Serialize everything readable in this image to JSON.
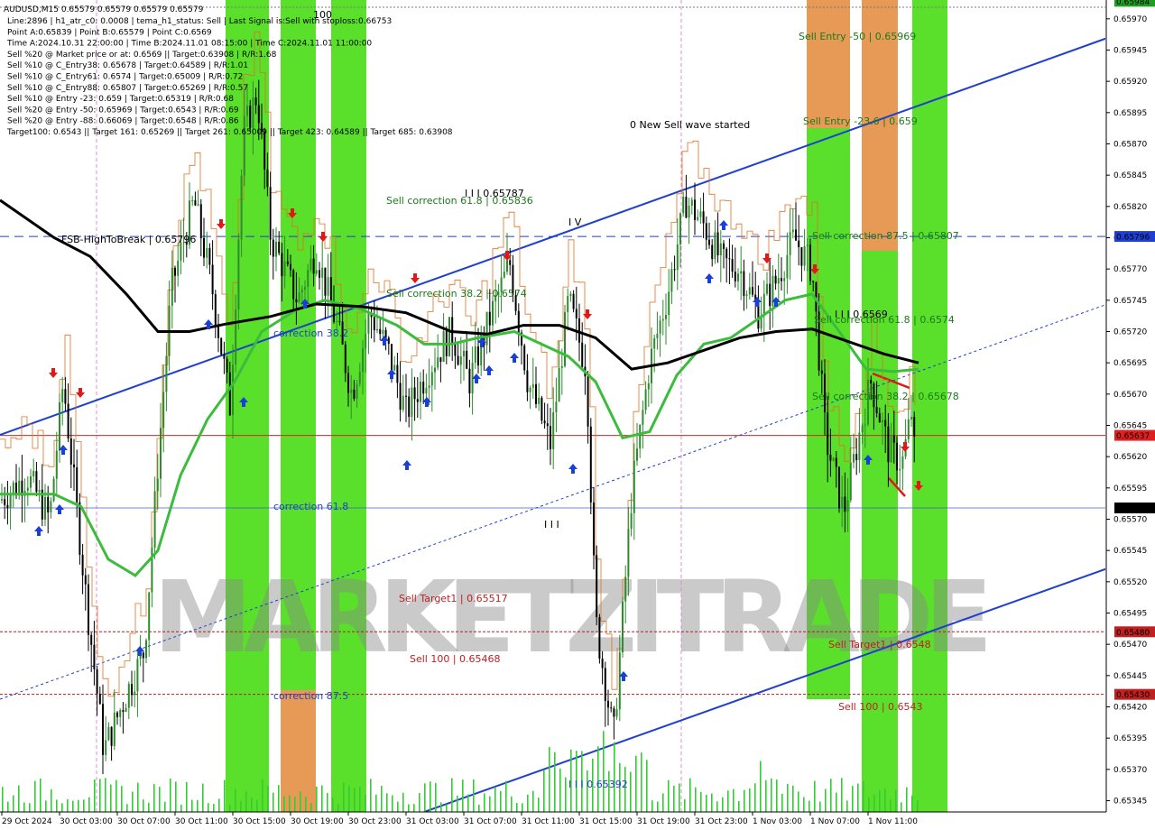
{
  "chart_data": {
    "type": "line",
    "symbol_line": "AUDUSD,M15  0.65579 0.65579 0.65579 0.65579",
    "info_lines": [
      "Line:2896 | h1_atr_c0: 0.0008 | tema_h1_status: Sell | Last Signal is:Sell with stoploss:0.66753",
      "Point A:0.65839 | Point B:0.65579 | Point C:0.6569",
      "Time A:2024.10.31 22:00:00 | Time B:2024.11.01 08:15:00 | Time C:2024.11.01 11:00:00",
      "Sell %20 @ Market price or at: 0.6569 || Target:0.63908 | R/R:1.68",
      "Sell %10 @ C_Entry38: 0.65678 | Target:0.64589 | R/R:1.01",
      "Sell %10 @ C_Entry61: 0.6574 | Target:0.65009 | R/R:0.72",
      "Sell %10 @ C_Entry88: 0.65807 | Target:0.65269 | R/R:0.57",
      "Sell %10 @ Entry -23: 0.659 | Target:0.65319 | R/R:0.68",
      "Sell %20 @ Entry -50: 0.65969 | Target:0.6543 | R/R:0.69",
      "Sell %20 @ Entry -88: 0.66069 | Target:0.6548 | R/R:0.86",
      "Target100: 0.6543 || Target 161: 0.65269 || Target 261: 0.65009 || Target 423: 0.64589 || Target 685: 0.63908"
    ],
    "y_ticks": [
      "0.65970",
      "0.65945",
      "0.65920",
      "0.65895",
      "0.65870",
      "0.65845",
      "0.65820",
      "0.65795",
      "0.65770",
      "0.65745",
      "0.65720",
      "0.65695",
      "0.65670",
      "0.65645",
      "0.65620",
      "0.65595",
      "0.65570",
      "0.65545",
      "0.65520",
      "0.65495",
      "0.65470",
      "0.65445",
      "0.65420",
      "0.65395",
      "0.65370",
      "0.65345"
    ],
    "y_range": [
      0.65336,
      0.65985
    ],
    "x_ticks": [
      "29 Oct 2024",
      "30 Oct 03:00",
      "30 Oct 07:00",
      "30 Oct 11:00",
      "30 Oct 15:00",
      "30 Oct 19:00",
      "30 Oct 23:00",
      "31 Oct 03:00",
      "31 Oct 07:00",
      "31 Oct 11:00",
      "31 Oct 15:00",
      "31 Oct 19:00",
      "31 Oct 23:00",
      "1 Nov 03:00",
      "1 Nov 07:00",
      "1 Nov 11:00"
    ],
    "price_tags": [
      {
        "value": 0.65984,
        "text": "0.65984",
        "bg": "#1e9e1e"
      },
      {
        "value": 0.65796,
        "text": "0.65796",
        "bg": "#1f3fd0"
      },
      {
        "value": 0.65637,
        "text": "0.65637",
        "bg": "#e02020"
      },
      {
        "value": 0.65579,
        "text": "0.65579",
        "bg": "#000000"
      },
      {
        "value": 0.6548,
        "text": "0.65480",
        "bg": "#c02020"
      },
      {
        "value": 0.6543,
        "text": "0.65430",
        "bg": "#c02020"
      }
    ],
    "annotations": [
      {
        "text": "Sell Entry -50 | 0.65969",
        "color": "#1a7a1a"
      },
      {
        "text": "Sell Entry -23.6 | 0.659",
        "color": "#1a7a1a"
      },
      {
        "text": "0 New Sell wave started",
        "color": "#000000"
      },
      {
        "text": "Sell correction 61.8 | 0.65836",
        "color": "#1a7a1a"
      },
      {
        "text": "I I I 0.65787",
        "color": "#000000"
      },
      {
        "text": "I V",
        "color": "#000000"
      },
      {
        "text": "FSB-HighToBreak | 0.65796",
        "color": "#000000"
      },
      {
        "text": "Sell correction 87.5 | 0.65807",
        "color": "#1a7a1a"
      },
      {
        "text": "Sell correction 38.2 | 0.6574",
        "color": "#1a7a1a"
      },
      {
        "text": "I I I 0.6569",
        "color": "#000000"
      },
      {
        "text": "Sell correction 61.8 | 0.6574",
        "color": "#1a7a1a"
      },
      {
        "text": "correction 38.2",
        "color": "#1f3fd0"
      },
      {
        "text": "Sell correction 38.2 | 0.65678",
        "color": "#1a7a1a"
      },
      {
        "text": "correction 61.8",
        "color": "#1f3fd0"
      },
      {
        "text": "I I I",
        "color": "#000000"
      },
      {
        "text": "Sell Target1 | 0.65517",
        "color": "#c02020"
      },
      {
        "text": "Sell 100 | 0.65468",
        "color": "#c02020"
      },
      {
        "text": "Sell Target1 | 0.6548",
        "color": "#c02020"
      },
      {
        "text": "Sell 100 | 0.6543",
        "color": "#c02020"
      },
      {
        "text": "correction 87.5",
        "color": "#1f3fd0"
      },
      {
        "text": "I I I 0.65392",
        "color": "#1f3fd0"
      },
      {
        "text": "100",
        "color": "#000000"
      }
    ],
    "watermark": "MARKETZITRADE",
    "grid": false,
    "colors": {
      "bull_candle": "#2e8b2e",
      "bear_candle": "#000000",
      "ma_green": "#3cbc3c",
      "ma_black": "#000000",
      "channel": "#1f3fd0",
      "stop_line": "#e07020",
      "zone_green": "#5ae02a",
      "zone_orange": "#e69a55",
      "sell_arrow": "#e01818",
      "buy_arrow": "#1840d8",
      "volume": "#33cc33"
    },
    "series": [
      {
        "name": "AUDUSD,M15",
        "close_path": [
          [
            0,
            0.65585
          ],
          [
            30,
            0.65605
          ],
          [
            55,
            0.6557
          ],
          [
            70,
            0.6568
          ],
          [
            95,
            0.6551
          ],
          [
            115,
            0.65385
          ],
          [
            140,
            0.6543
          ],
          [
            160,
            0.65465
          ],
          [
            175,
            0.65615
          ],
          [
            190,
            0.65755
          ],
          [
            215,
            0.65825
          ],
          [
            235,
            0.65755
          ],
          [
            255,
            0.6566
          ],
          [
            270,
            0.6588
          ],
          [
            285,
            0.6591
          ],
          [
            300,
            0.65795
          ],
          [
            330,
            0.65745
          ],
          [
            350,
            0.65785
          ],
          [
            375,
            0.6572
          ],
          [
            390,
            0.6567
          ],
          [
            410,
            0.65735
          ],
          [
            430,
            0.65705
          ],
          [
            450,
            0.65655
          ],
          [
            475,
            0.6569
          ],
          [
            500,
            0.6572
          ],
          [
            520,
            0.6568
          ],
          [
            545,
            0.65735
          ],
          [
            565,
            0.65775
          ],
          [
            585,
            0.6568
          ],
          [
            610,
            0.6563
          ],
          [
            630,
            0.65745
          ],
          [
            650,
            0.6569
          ],
          [
            660,
            0.6549
          ],
          [
            680,
            0.65395
          ],
          [
            700,
            0.6559
          ],
          [
            720,
            0.65695
          ],
          [
            740,
            0.6575
          ],
          [
            760,
            0.65825
          ],
          [
            780,
            0.65805
          ],
          [
            800,
            0.65775
          ],
          [
            820,
            0.6577
          ],
          [
            840,
            0.65735
          ],
          [
            860,
            0.6576
          ],
          [
            880,
            0.65795
          ],
          [
            900,
            0.6577
          ],
          [
            915,
            0.65635
          ],
          [
            935,
            0.65575
          ],
          [
            950,
            0.6563
          ],
          [
            965,
            0.6568
          ],
          [
            985,
            0.65625
          ],
          [
            1000,
            0.65615
          ],
          [
            1010,
            0.65655
          ],
          [
            1018,
            0.65579
          ]
        ]
      },
      {
        "name": "ma_green",
        "path": [
          [
            0,
            0.6559
          ],
          [
            60,
            0.6559
          ],
          [
            90,
            0.6558
          ],
          [
            120,
            0.65538
          ],
          [
            150,
            0.65525
          ],
          [
            175,
            0.65545
          ],
          [
            200,
            0.65605
          ],
          [
            230,
            0.6565
          ],
          [
            260,
            0.6568
          ],
          [
            290,
            0.6572
          ],
          [
            330,
            0.65738
          ],
          [
            360,
            0.65745
          ],
          [
            400,
            0.65738
          ],
          [
            440,
            0.65725
          ],
          [
            470,
            0.6571
          ],
          [
            500,
            0.6571
          ],
          [
            530,
            0.65715
          ],
          [
            570,
            0.6572
          ],
          [
            600,
            0.6571
          ],
          [
            630,
            0.657
          ],
          [
            660,
            0.6568
          ],
          [
            690,
            0.65635
          ],
          [
            720,
            0.6564
          ],
          [
            750,
            0.65685
          ],
          [
            780,
            0.6571
          ],
          [
            810,
            0.65715
          ],
          [
            840,
            0.6573
          ],
          [
            870,
            0.65745
          ],
          [
            900,
            0.6575
          ],
          [
            930,
            0.6572
          ],
          [
            960,
            0.6569
          ],
          [
            990,
            0.65688
          ],
          [
            1018,
            0.6569
          ]
        ]
      },
      {
        "name": "ma_black",
        "path": [
          [
            0,
            0.65825
          ],
          [
            60,
            0.65795
          ],
          [
            100,
            0.6578
          ],
          [
            140,
            0.6575
          ],
          [
            175,
            0.6572
          ],
          [
            210,
            0.6572
          ],
          [
            250,
            0.65726
          ],
          [
            300,
            0.65732
          ],
          [
            350,
            0.65742
          ],
          [
            400,
            0.6574
          ],
          [
            450,
            0.65735
          ],
          [
            500,
            0.6572
          ],
          [
            540,
            0.65718
          ],
          [
            580,
            0.65725
          ],
          [
            620,
            0.65725
          ],
          [
            660,
            0.65715
          ],
          [
            700,
            0.6569
          ],
          [
            740,
            0.65695
          ],
          [
            780,
            0.65705
          ],
          [
            820,
            0.65715
          ],
          [
            860,
            0.6572
          ],
          [
            900,
            0.65722
          ],
          [
            940,
            0.65712
          ],
          [
            980,
            0.65702
          ],
          [
            1018,
            0.65695
          ]
        ]
      }
    ]
  }
}
